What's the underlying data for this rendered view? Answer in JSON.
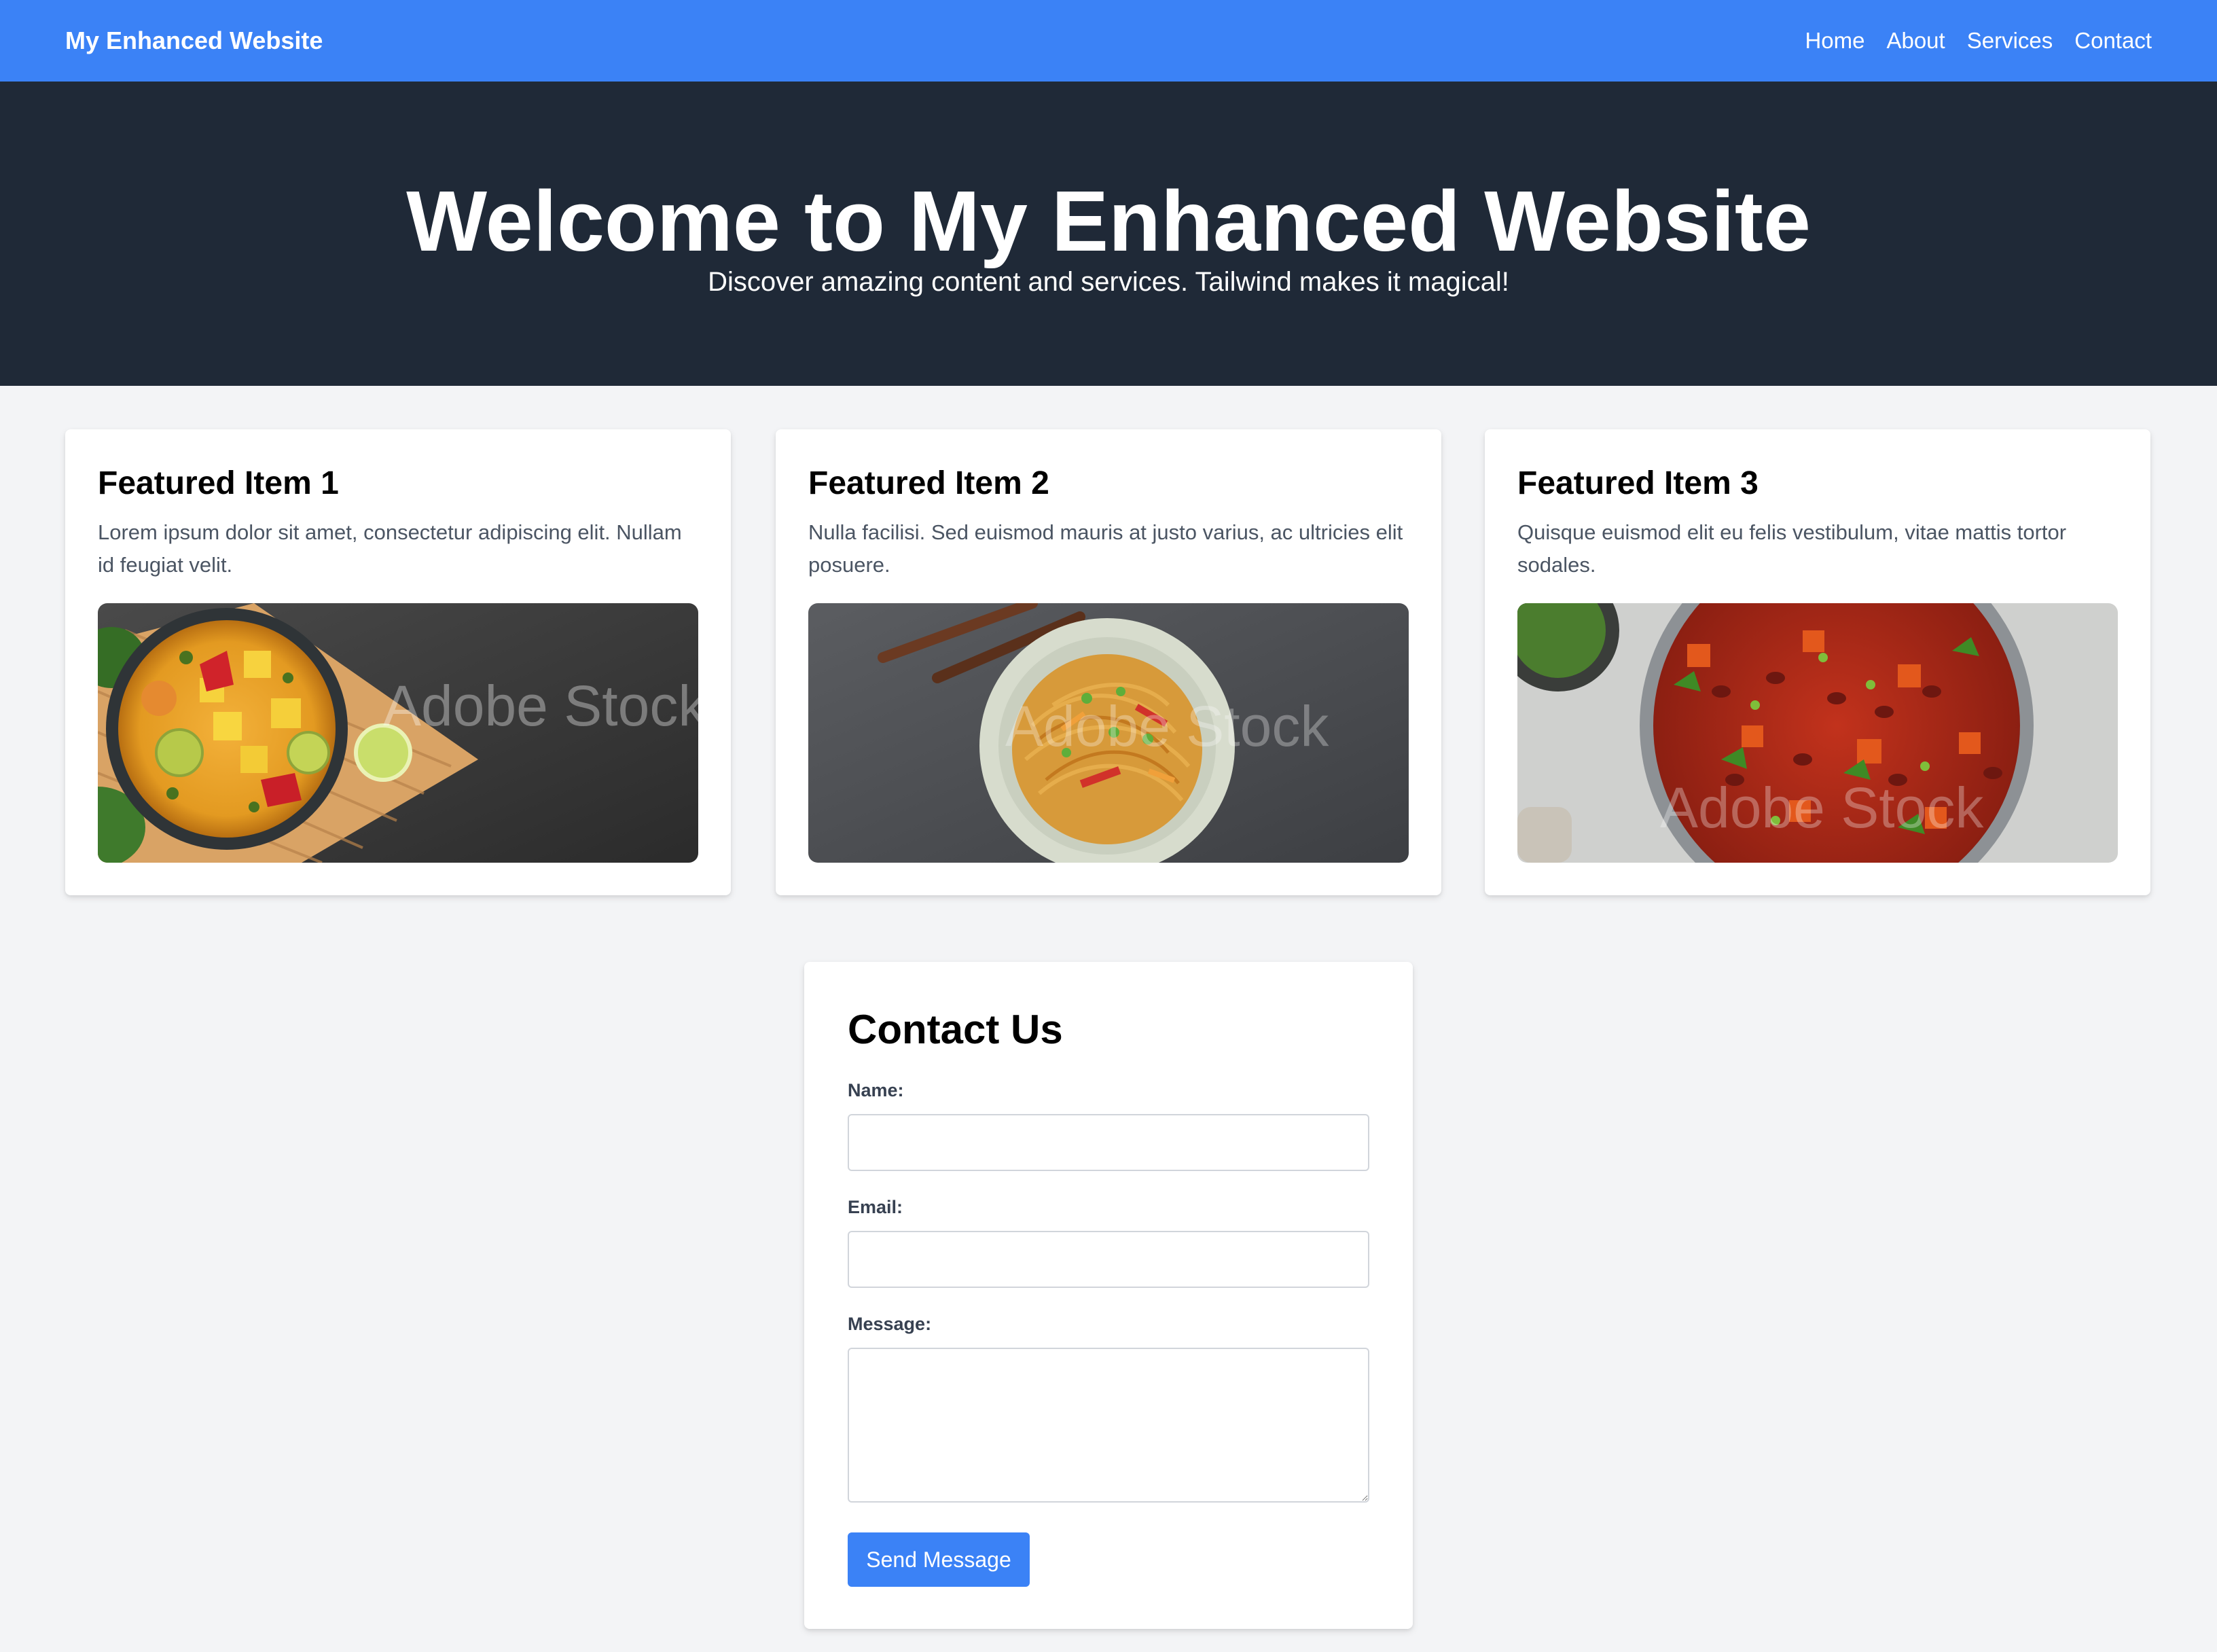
{
  "nav": {
    "brand": "My Enhanced Website",
    "links": [
      "Home",
      "About",
      "Services",
      "Contact"
    ]
  },
  "hero": {
    "title": "Welcome to My Enhanced Website",
    "subtitle": "Discover amazing content and services. Tailwind makes it magical!"
  },
  "cards": [
    {
      "title": "Featured Item 1",
      "description": "Lorem ipsum dolor sit amet, consectetur adipiscing elit. Nullam id feugiat velit.",
      "image": "curry-bowl-photo",
      "watermark": "Adobe Stock"
    },
    {
      "title": "Featured Item 2",
      "description": "Nulla facilisi. Sed euismod mauris at justo varius, ac ultricies elit posuere.",
      "image": "noodles-bowl-photo",
      "watermark": "Adobe Stock"
    },
    {
      "title": "Featured Item 3",
      "description": "Quisque euismod elit eu felis vestibulum, vitae mattis tortor sodales.",
      "image": "bean-stew-pan-photo",
      "watermark": "Adobe Stock"
    }
  ],
  "contact": {
    "title": "Contact Us",
    "name_label": "Name:",
    "name_value": "",
    "email_label": "Email:",
    "email_value": "",
    "message_label": "Message:",
    "message_value": "",
    "submit_label": "Send Message"
  },
  "colors": {
    "nav_bg": "#3b82f6",
    "hero_bg": "#1f2937",
    "page_bg": "#f3f4f6",
    "button_bg": "#3b82f6"
  }
}
